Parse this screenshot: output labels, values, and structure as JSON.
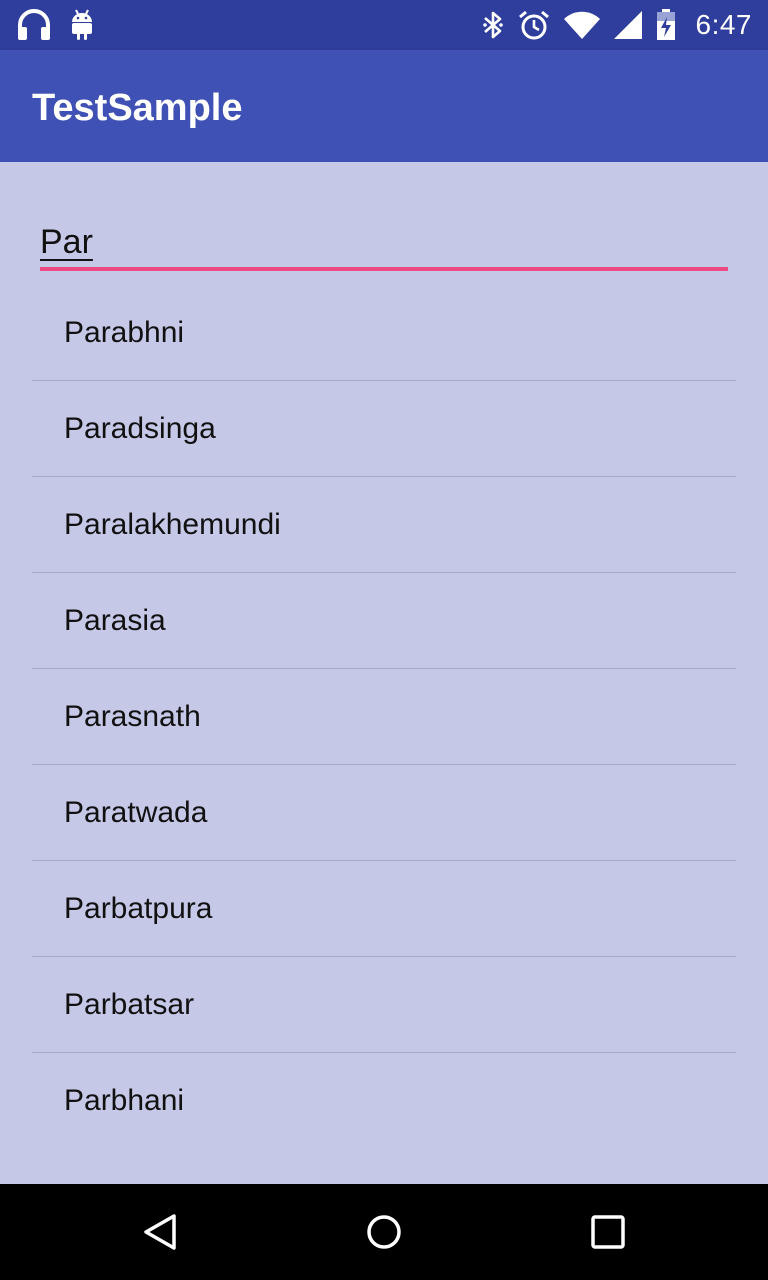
{
  "status_bar": {
    "time": "6:47",
    "left_icons": [
      "headphones-icon",
      "android-icon"
    ],
    "right_icons": [
      "bluetooth-icon",
      "alarm-icon",
      "wifi-icon",
      "signal-icon",
      "battery-icon"
    ]
  },
  "app_bar": {
    "title": "TestSample",
    "color": "#3f51b5"
  },
  "search": {
    "value": "Par",
    "accent_color": "#ee4a82"
  },
  "suggestions": [
    "Parabhni",
    "Paradsinga",
    "Paralakhemundi",
    "Parasia",
    "Parasnath",
    "Paratwada",
    "Parbatpura",
    "Parbatsar",
    "Parbhani"
  ],
  "nav_bar": {
    "buttons": [
      "back-icon",
      "home-icon",
      "recents-icon"
    ]
  }
}
